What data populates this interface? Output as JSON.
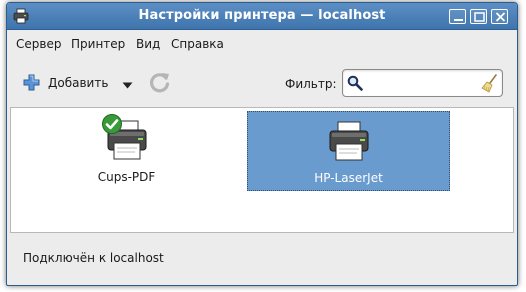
{
  "window": {
    "title": "Настройки принтера — localhost"
  },
  "menu": {
    "items": [
      "Сервер",
      "Принтер",
      "Вид",
      "Справка"
    ]
  },
  "toolbar": {
    "add_label": "Добавить",
    "filter_label": "Фильтр:",
    "filter_value": ""
  },
  "printers": [
    {
      "name": "Cups-PDF",
      "is_default": true,
      "selected": false
    },
    {
      "name": "HP-LaserJet",
      "is_default": false,
      "selected": true
    }
  ],
  "status": {
    "text": "Подключён к localhost"
  },
  "icons": {
    "app": "printer-icon",
    "add": "plus-icon",
    "dropdown": "dropdown-arrow-icon",
    "refresh": "refresh-icon",
    "search": "search-icon",
    "clear": "clear-broom-icon",
    "default_badge": "checkmark-icon"
  },
  "colors": {
    "titlebar": "#4a80ba",
    "selection": "#6a9bcf",
    "default_badge": "#2e8b2e"
  }
}
